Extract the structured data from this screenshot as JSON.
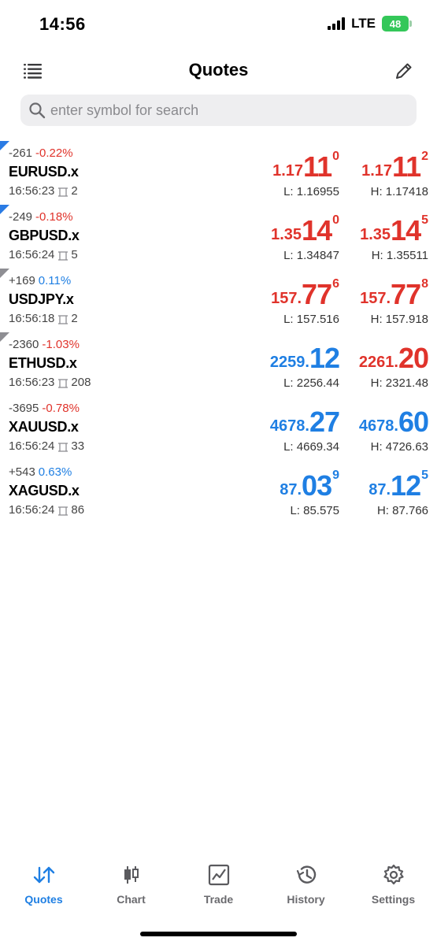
{
  "status_bar": {
    "time": "14:56",
    "network": "LTE",
    "battery": "48"
  },
  "header": {
    "title": "Quotes"
  },
  "search": {
    "placeholder": "enter symbol for search"
  },
  "colors": {
    "down": "#e0332b",
    "up": "#1f7fe3",
    "marker_blue": "#2a7be4",
    "marker_gray": "#8e8e93"
  },
  "quotes": [
    {
      "marker": "blue",
      "change_points": "-261",
      "change_percent": "-0.22%",
      "change_color": "red",
      "symbol": "EURUSD.x",
      "time": "16:56:23",
      "spread": "2",
      "bid": {
        "pre": "1.17",
        "big": "11",
        "sup": "0",
        "color": "red"
      },
      "ask": {
        "pre": "1.17",
        "big": "11",
        "sup": "2",
        "color": "red"
      },
      "low": "L: 1.16955",
      "high": "H: 1.17418"
    },
    {
      "marker": "blue",
      "change_points": "-249",
      "change_percent": "-0.18%",
      "change_color": "red",
      "symbol": "GBPUSD.x",
      "time": "16:56:24",
      "spread": "5",
      "bid": {
        "pre": "1.35",
        "big": "14",
        "sup": "0",
        "color": "red"
      },
      "ask": {
        "pre": "1.35",
        "big": "14",
        "sup": "5",
        "color": "red"
      },
      "low": "L: 1.34847",
      "high": "H: 1.35511"
    },
    {
      "marker": "gray",
      "change_points": "+169",
      "change_percent": "0.11%",
      "change_color": "blue",
      "symbol": "USDJPY.x",
      "time": "16:56:18",
      "spread": "2",
      "bid": {
        "pre": "157.",
        "big": "77",
        "sup": "6",
        "color": "red"
      },
      "ask": {
        "pre": "157.",
        "big": "77",
        "sup": "8",
        "color": "red"
      },
      "low": "L: 157.516",
      "high": "H: 157.918"
    },
    {
      "marker": "gray",
      "change_points": "-2360",
      "change_percent": "-1.03%",
      "change_color": "red",
      "symbol": "ETHUSD.x",
      "time": "16:56:23",
      "spread": "208",
      "bid": {
        "pre": "2259.",
        "big": "12",
        "sup": "",
        "color": "blue"
      },
      "ask": {
        "pre": "2261.",
        "big": "20",
        "sup": "",
        "color": "red"
      },
      "low": "L: 2256.44",
      "high": "H: 2321.48"
    },
    {
      "marker": "none",
      "change_points": "-3695",
      "change_percent": "-0.78%",
      "change_color": "red",
      "symbol": "XAUUSD.x",
      "time": "16:56:24",
      "spread": "33",
      "bid": {
        "pre": "4678.",
        "big": "27",
        "sup": "",
        "color": "blue"
      },
      "ask": {
        "pre": "4678.",
        "big": "60",
        "sup": "",
        "color": "blue"
      },
      "low": "L: 4669.34",
      "high": "H: 4726.63"
    },
    {
      "marker": "none",
      "change_points": "+543",
      "change_percent": "0.63%",
      "change_color": "blue",
      "symbol": "XAGUSD.x",
      "time": "16:56:24",
      "spread": "86",
      "bid": {
        "pre": "87.",
        "big": "03",
        "sup": "9",
        "color": "blue"
      },
      "ask": {
        "pre": "87.",
        "big": "12",
        "sup": "5",
        "color": "blue"
      },
      "low": "L: 85.575",
      "high": "H: 87.766"
    }
  ],
  "tabs": [
    {
      "label": "Quotes",
      "icon": "quotes-arrows-icon",
      "active": true
    },
    {
      "label": "Chart",
      "icon": "candlestick-icon",
      "active": false
    },
    {
      "label": "Trade",
      "icon": "trade-chart-icon",
      "active": false
    },
    {
      "label": "History",
      "icon": "history-clock-icon",
      "active": false
    },
    {
      "label": "Settings",
      "icon": "gear-icon",
      "active": false
    }
  ]
}
